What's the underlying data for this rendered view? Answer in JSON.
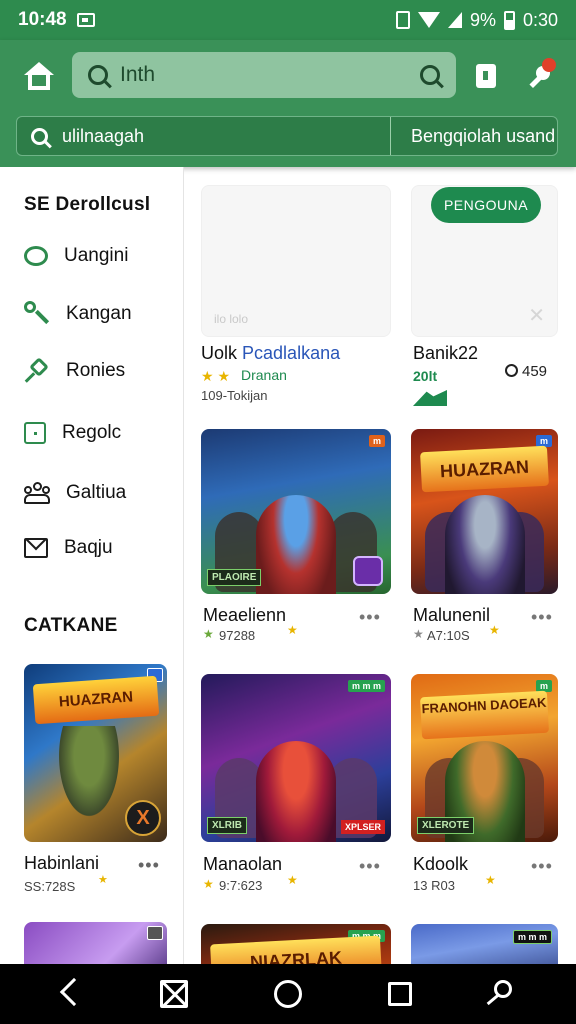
{
  "status_bar": {
    "time": "10:48",
    "battery": "9%",
    "clock_right": "0:30"
  },
  "header": {
    "search_placeholder": "Inth",
    "search_query": "ulilnaagah",
    "filter_label": "Bengqiolah usand"
  },
  "sidebar": {
    "heading": "SE Derollcusl",
    "items": [
      {
        "label": "Uangini",
        "icon": "oval-icon"
      },
      {
        "label": "Kangan",
        "icon": "wrench-icon"
      },
      {
        "label": "Ronies",
        "icon": "pin-icon"
      },
      {
        "label": "Regolc",
        "icon": "square-icon"
      },
      {
        "label": "Galtiua",
        "icon": "people-icon"
      },
      {
        "label": "Baqju",
        "icon": "mail-icon"
      }
    ],
    "section_heading": "CATKANE",
    "card": {
      "banner": "HUAZRAN",
      "badge": "X",
      "name": "Habinlani",
      "size": "SS:728S"
    }
  },
  "grid": {
    "featured": {
      "pill_button": "PENGOUNA",
      "faint_text": "ilo lolo",
      "left_name_prefix": "Uolk",
      "left_name_accent": "Pcadlalkana",
      "left_rating_label": "Dranan",
      "left_meta": "109-Tokijan",
      "right_name": "Banik22",
      "right_sub": "20lt",
      "right_clock": "459"
    },
    "cards": [
      {
        "name": "Meaelienn",
        "meta": "97288",
        "corner": "m",
        "logo": "PLAOIRE"
      },
      {
        "name": "Malunenil",
        "meta": "A7:10S",
        "corner": "m",
        "banner": "HUAZRAN"
      },
      {
        "name": "Manaolan",
        "meta": "9:7:623",
        "corner": "m m m",
        "logo": "XLRIB",
        "red_tag": "XPLSER"
      },
      {
        "name": "Kdoolk",
        "meta": "13 R03",
        "corner": "m",
        "banner": "FRANOHN DAOEAK",
        "logo": "XLEROTE"
      }
    ],
    "bottom_row": [
      {
        "banner": "NIAZRLAK",
        "corner": "m m m"
      },
      {
        "corner": "m m m"
      }
    ]
  },
  "colors": {
    "primary": "#2e8b4e",
    "header": "#3a9158",
    "accent_blue": "#2a56b8",
    "star": "#e8b500"
  }
}
